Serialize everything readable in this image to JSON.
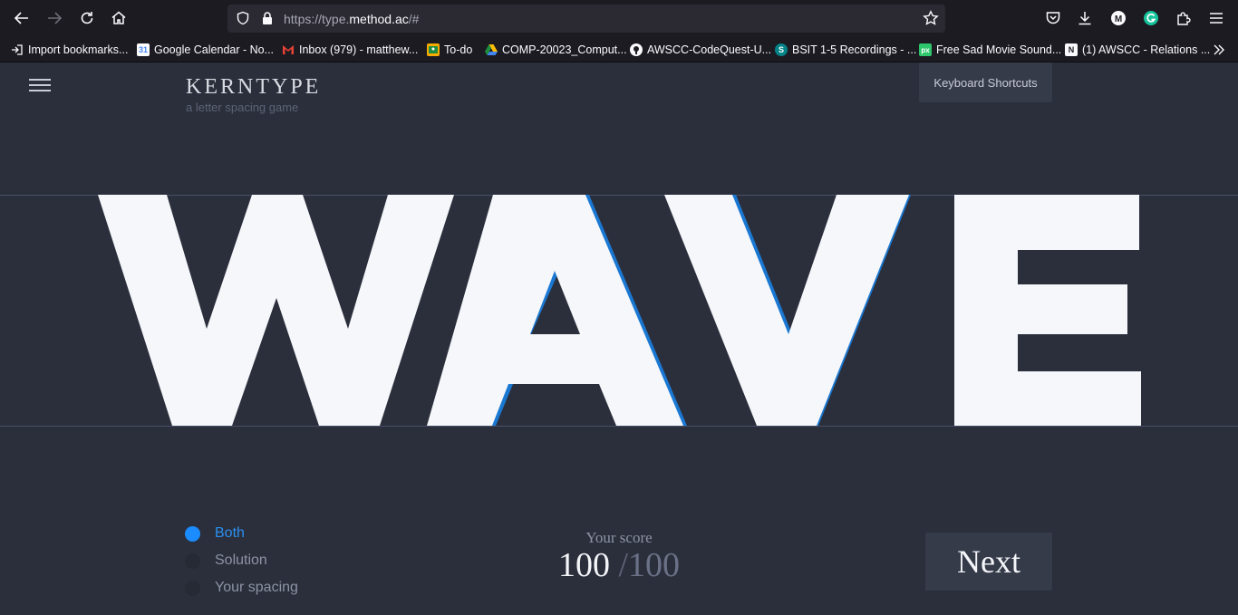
{
  "browser": {
    "url_prefix": "https://type.",
    "url_domain": "method.ac",
    "url_suffix": "/#",
    "bookmarks": [
      {
        "label": "Import bookmarks...",
        "icon": "import-icon"
      },
      {
        "label": "Google Calendar - No...",
        "icon": "calendar-icon"
      },
      {
        "label": "Inbox (979) - matthew...",
        "icon": "gmail-icon"
      },
      {
        "label": "To-do",
        "icon": "classroom-icon"
      },
      {
        "label": "COMP-20023_Comput...",
        "icon": "drive-icon"
      },
      {
        "label": "AWSCC-CodeQuest-U...",
        "icon": "github-icon"
      },
      {
        "label": "BSIT 1-5 Recordings - ...",
        "icon": "sharepoint-icon"
      },
      {
        "label": "Free Sad Movie Sound...",
        "icon": "pixabay-icon"
      },
      {
        "label": "(1) AWSCC - Relations ...",
        "icon": "notion-icon"
      }
    ]
  },
  "app": {
    "logo": "KERNTYPE",
    "tagline": "a letter spacing game",
    "keyboard_shortcuts": "Keyboard Shortcuts",
    "word": "WAVE",
    "views": [
      {
        "label": "Both",
        "active": true
      },
      {
        "label": "Solution",
        "active": false
      },
      {
        "label": "Your spacing",
        "active": false
      }
    ],
    "score_label": "Your score",
    "score": "100",
    "score_max": "100",
    "next_label": "Next"
  },
  "colors": {
    "background": "#2b2f3c",
    "letter": "#f5f7fa",
    "solution_outline": "#1a78d2",
    "accent": "#1a8cff"
  }
}
